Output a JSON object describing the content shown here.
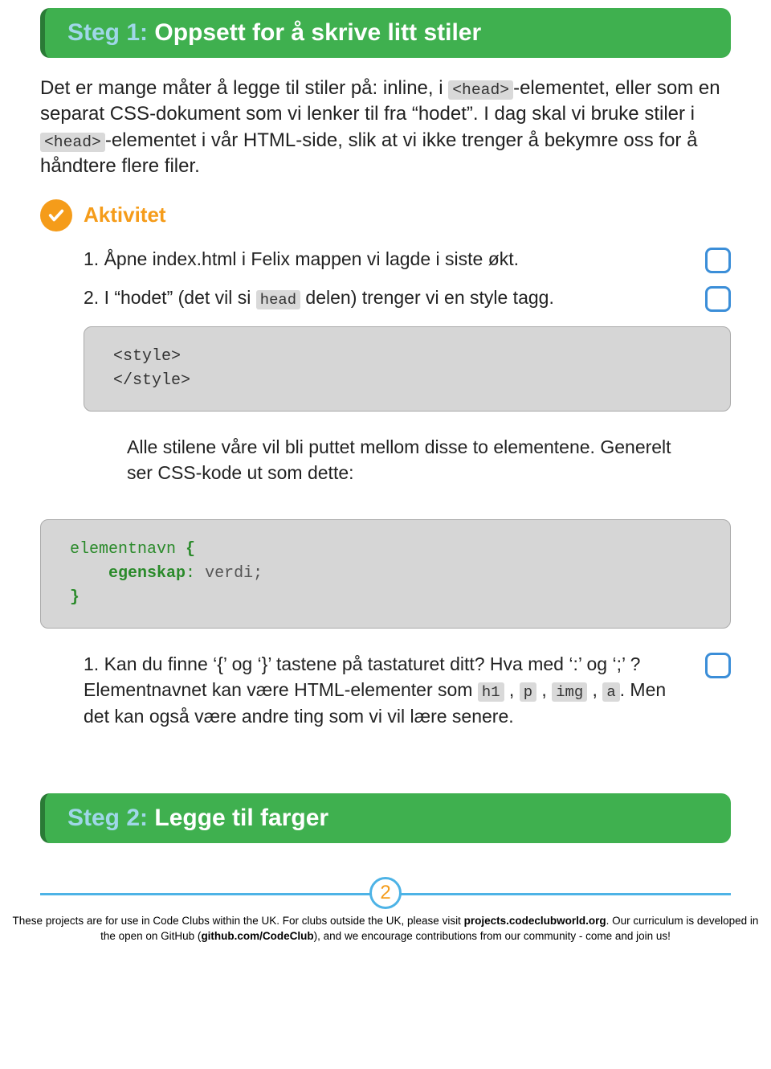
{
  "step1": {
    "label": "Steg 1:",
    "title": "Oppsett for å skrive litt stiler"
  },
  "intro": {
    "part1": "Det er mange måter å legge til stiler på: inline, i ",
    "code1": "<head>",
    "part2": "-elementet, eller som en separat CSS-dokument som vi lenker til fra “hodet”. I dag skal vi bruke stiler i ",
    "code2": "<head>",
    "part3": "-elementet i vår HTML-side, slik at vi ikke trenger å bekymre oss for å håndtere flere filer."
  },
  "activity": {
    "title": "Aktivitet",
    "items": [
      {
        "num": "1.",
        "text": "Åpne index.html i Felix mappen vi lagde i siste økt."
      },
      {
        "num": "2.",
        "text_pre": "I “hodet” (det vil si ",
        "code": "head",
        "text_post": " delen) trenger vi en style tagg."
      }
    ]
  },
  "codeblock1": "<style>\n</style>",
  "mid_text": "Alle stilene våre vil bli puttet mellom disse to elementene. Generelt ser CSS-kode ut som dette:",
  "codeblock2": {
    "line1_name": "elementnavn",
    "line2_prop": "egenskap",
    "line2_val": "verdi"
  },
  "tasks": [
    {
      "num": "1.",
      "p1": "Kan du finne ‘{’ og ‘}’ tastene på tastaturet ditt? Hva med ‘:’ og ‘;’ ?",
      "p2_pre": "Elementnavnet kan være HTML-elementer som ",
      "c1": "h1",
      "c2": "p",
      "c3": "img",
      "c4": "a",
      "p2_mid1": " , ",
      "p2_mid2": " , ",
      "p2_mid3": " , ",
      "p2_post": ". Men det kan også være andre ting som vi vil lære senere."
    }
  ],
  "step2": {
    "label": "Steg 2:",
    "title": "Legge til farger"
  },
  "page_number": "2",
  "footer": {
    "t1": "These projects are for use in Code Clubs within the UK. For clubs outside the UK, please visit ",
    "link1": "projects.codeclubworld.org",
    "t2": ". Our curriculum is developed in the open on GitHub (",
    "link2": "github.com/CodeClub",
    "t3": "), and we encourage contributions from our community - come and join us!"
  }
}
